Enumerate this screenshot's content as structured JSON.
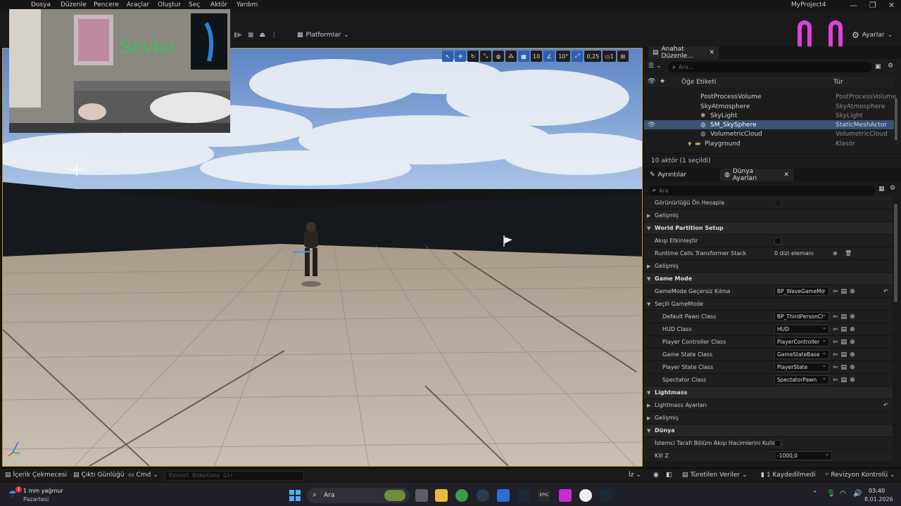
{
  "menu": [
    "Dosya",
    "Düzenle",
    "Pencere",
    "Araçlar",
    "Oluştur",
    "Seç",
    "Aktör",
    "Yardım"
  ],
  "project_title": "MyProject4",
  "toolbar": {
    "platforms": "Platformlar",
    "settings": "Ayarlar"
  },
  "viewport_tools": {
    "grid": "10",
    "angle": "10°",
    "scale": "0,25",
    "camera": "1"
  },
  "outliner": {
    "tab": "Anahat Düzenle...",
    "search_placeholder": "Ara...",
    "col_label": "Öğe Etiketi",
    "col_type": "Tür",
    "rows": [
      {
        "name": "PostProcessVolume",
        "type": "PostProcessVolume"
      },
      {
        "name": "SkyAtmosphere",
        "type": "SkyAtmosphere"
      },
      {
        "name": "SkyLight",
        "type": "SkyLight"
      },
      {
        "name": "SM_SkySphere",
        "type": "StaticMeshActor"
      },
      {
        "name": "VolumetricCloud",
        "type": "VolumetricCloud"
      },
      {
        "name": "Playground",
        "type": "Klasör"
      }
    ],
    "status": "10 aktör (1 seçildi)"
  },
  "details": {
    "tab1": "Ayrıntılar",
    "tab2": "Dünya Ayarları",
    "search_placeholder": "Ara",
    "rows": {
      "visibility": "Görünürlüğü Ön Hesapla",
      "advanced1": "Gelişmiş",
      "wp_setup": "World Partition Setup",
      "enable_stream": "Akışı Etkinleştir",
      "rcts": "Runtime Cells Transformer Stack",
      "rcts_val": "0 dizi elemanı",
      "advanced2": "Gelişmiş",
      "game_mode": "Game Mode",
      "gm_override": "GameMode Geçersiz Kılma",
      "gm_override_val": "BP_WaveGameMo",
      "selected_gm": "Seçili GameMode",
      "pawn": "Default Pawn Class",
      "pawn_val": "BP_ThirdPersonCl",
      "hud": "HUD Class",
      "hud_val": "HUD",
      "pc": "Player Controller Class",
      "pc_val": "PlayerController",
      "gs": "Game State Class",
      "gs_val": "GameStateBase",
      "ps": "Player State Class",
      "ps_val": "PlayerState",
      "spec": "Spectator Class",
      "spec_val": "SpectatorPawn",
      "lightmass": "Lightmass",
      "lightmass_settings": "Lightmass Ayarları",
      "advanced3": "Gelişmiş",
      "world": "Dünya",
      "client_stream": "İstemci Tarafı Bölüm Akışı Hacimlerini Kullan",
      "killz": "Kill Z",
      "killz_val": "-1000,0"
    }
  },
  "bottombar": {
    "content_drawer": "İçerik Çekmecesi",
    "output_log": "Çıktı Günlüğü",
    "cmd": "Cmd",
    "console_placeholder": "Konsol Komutunu Gir",
    "trace": "İz",
    "derived_data": "Türetilen Veriler",
    "unsaved": "1 Kaydedilmedi",
    "revision": "Revizyon Kontrolü"
  },
  "taskbar": {
    "weather": "1 mm yağmur",
    "day": "Pazartesi",
    "weather_badge": "1",
    "search": "Ara",
    "time": "03:40",
    "date": "8.01.2026"
  },
  "webcam_sign": "Sevko",
  "colors": {
    "accent": "#2c5fb0",
    "selection": "#3a5276",
    "mascot": "#e040d8"
  }
}
